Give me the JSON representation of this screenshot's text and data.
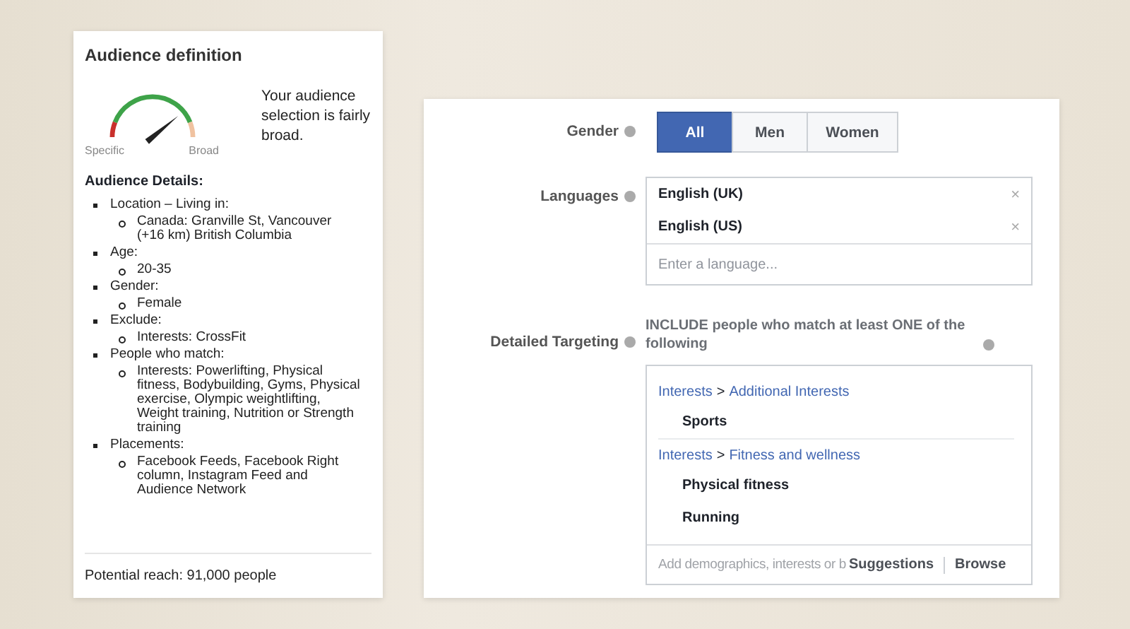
{
  "audience": {
    "title": "Audience definition",
    "gauge": {
      "min_label": "Specific",
      "max_label": "Broad"
    },
    "summary": "Your audience selection is fairly broad.",
    "details_title": "Audience Details:",
    "details": [
      {
        "text": "Location – Living in:",
        "children": [
          {
            "text": "Canada: Granville St, Vancouver (+16 km) British Columbia"
          }
        ]
      },
      {
        "text": "Age:",
        "children": [
          {
            "text": "20-35"
          }
        ]
      },
      {
        "text": "Gender:",
        "children": [
          {
            "text": "Female"
          }
        ]
      },
      {
        "text": "Exclude:",
        "children": [
          {
            "text": "Interests: CrossFit"
          }
        ]
      },
      {
        "text": "People who match:",
        "children": [
          {
            "text": "Interests: Powerlifting, Physical fitness, Bodybuilding, Gyms, Physical exercise, Olympic weightlifting, Weight training, Nutrition or Strength training"
          }
        ]
      },
      {
        "text": "Placements:",
        "children": [
          {
            "text": "Facebook Feeds, Facebook Right column, Instagram Feed and Audience Network"
          }
        ]
      }
    ],
    "reach": "Potential reach: 91,000 people"
  },
  "form": {
    "gender": {
      "label": "Gender",
      "options": [
        {
          "label": "All",
          "selected": true
        },
        {
          "label": "Men",
          "selected": false
        },
        {
          "label": "Women",
          "selected": false
        }
      ]
    },
    "languages": {
      "label": "Languages",
      "items": [
        "English (UK)",
        "English (US)"
      ],
      "remove": "×",
      "placeholder": "Enter a language..."
    },
    "targeting": {
      "label": "Detailed Targeting",
      "intro": "INCLUDE people who match at least ONE of the following",
      "groups": [
        {
          "path": [
            "Interests",
            "Additional Interests"
          ],
          "separator": ">",
          "items": [
            "Sports"
          ]
        },
        {
          "path": [
            "Interests",
            "Fitness and wellness"
          ],
          "separator": ">",
          "items": [
            "Physical fitness",
            "Running"
          ]
        }
      ],
      "placeholder": "Add demographics, interests or b",
      "links": [
        "Suggestions",
        "Browse"
      ]
    }
  }
}
